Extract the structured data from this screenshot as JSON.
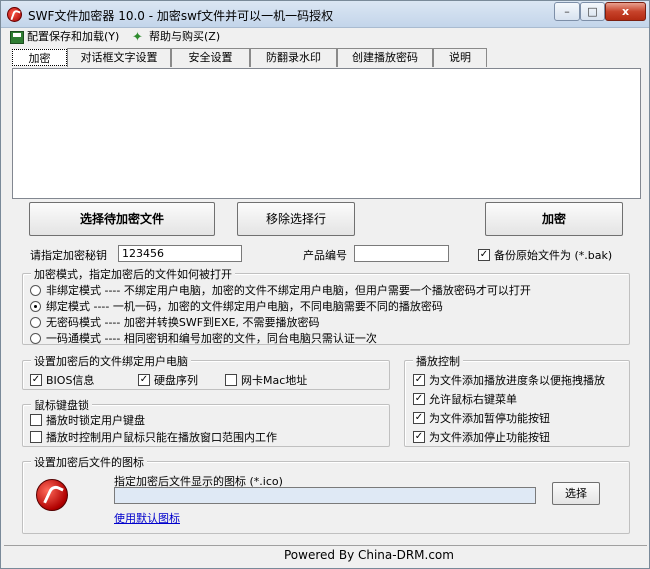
{
  "window": {
    "title": "SWF文件加密器 10.0 - 加密swf文件并可以一机一码授权",
    "min_label": "–",
    "max_label": "□",
    "close_label": "x"
  },
  "menu": {
    "items": [
      {
        "label": "配置保存和加载(Y)",
        "icon": "save-icon"
      },
      {
        "label": "帮助与购买(Z)",
        "icon": "help-icon"
      }
    ]
  },
  "tabs": [
    "加密",
    "对话框文字设置",
    "安全设置",
    "防翻录水印",
    "创建播放密码",
    "说明"
  ],
  "active_tab": 0,
  "buttons": {
    "select_files": "选择待加密文件",
    "remove_selected": "移除选择行",
    "encrypt": "加密"
  },
  "fields": {
    "key_label": "请指定加密秘钥",
    "key_value": "123456",
    "product_label": "产品编号",
    "product_value": "",
    "backup_label": "备份原始文件为 (*.bak)",
    "backup_checked": true
  },
  "mode_group": {
    "title": "加密模式，指定加密后的文件如何被打开",
    "options": [
      {
        "label": "非绑定模式 ---- 不绑定用户电脑，加密的文件不绑定用户电脑，但用户需要一个播放密码才可以打开",
        "selected": false
      },
      {
        "label": "绑定模式 ---- 一机一码，加密的文件绑定用户电脑，不同电脑需要不同的播放密码",
        "selected": true
      },
      {
        "label": "无密码模式 ---- 加密并转换SWF到EXE, 不需要播放密码",
        "selected": false
      },
      {
        "label": "一码通模式 ---- 相同密钥和编号加密的文件，同台电脑只需认证一次",
        "selected": false
      }
    ]
  },
  "bind_group": {
    "title": "设置加密后的文件绑定用户电脑",
    "items": [
      {
        "label": "BIOS信息",
        "checked": true
      },
      {
        "label": "硬盘序列",
        "checked": true
      },
      {
        "label": "网卡Mac地址",
        "checked": false
      }
    ]
  },
  "play_group": {
    "title": "播放控制",
    "items": [
      {
        "label": "为文件添加播放进度条以便拖拽播放",
        "checked": true
      },
      {
        "label": "允许鼠标右键菜单",
        "checked": true
      },
      {
        "label": "为文件添加暂停功能按钮",
        "checked": true
      },
      {
        "label": "为文件添加停止功能按钮",
        "checked": true
      }
    ]
  },
  "mouse_group": {
    "title": "鼠标键盘锁",
    "items": [
      {
        "label": "播放时锁定用户键盘",
        "checked": false
      },
      {
        "label": "播放时控制用户鼠标只能在播放窗口范围内工作",
        "checked": false
      }
    ]
  },
  "icon_group": {
    "title": "设置加密后文件的图标",
    "desc": "指定加密后文件显示的图标 (*.ico)",
    "path_value": "",
    "choose_label": "选择",
    "default_link": "使用默认图标"
  },
  "status": {
    "text": "Powered By China-DRM.com"
  }
}
